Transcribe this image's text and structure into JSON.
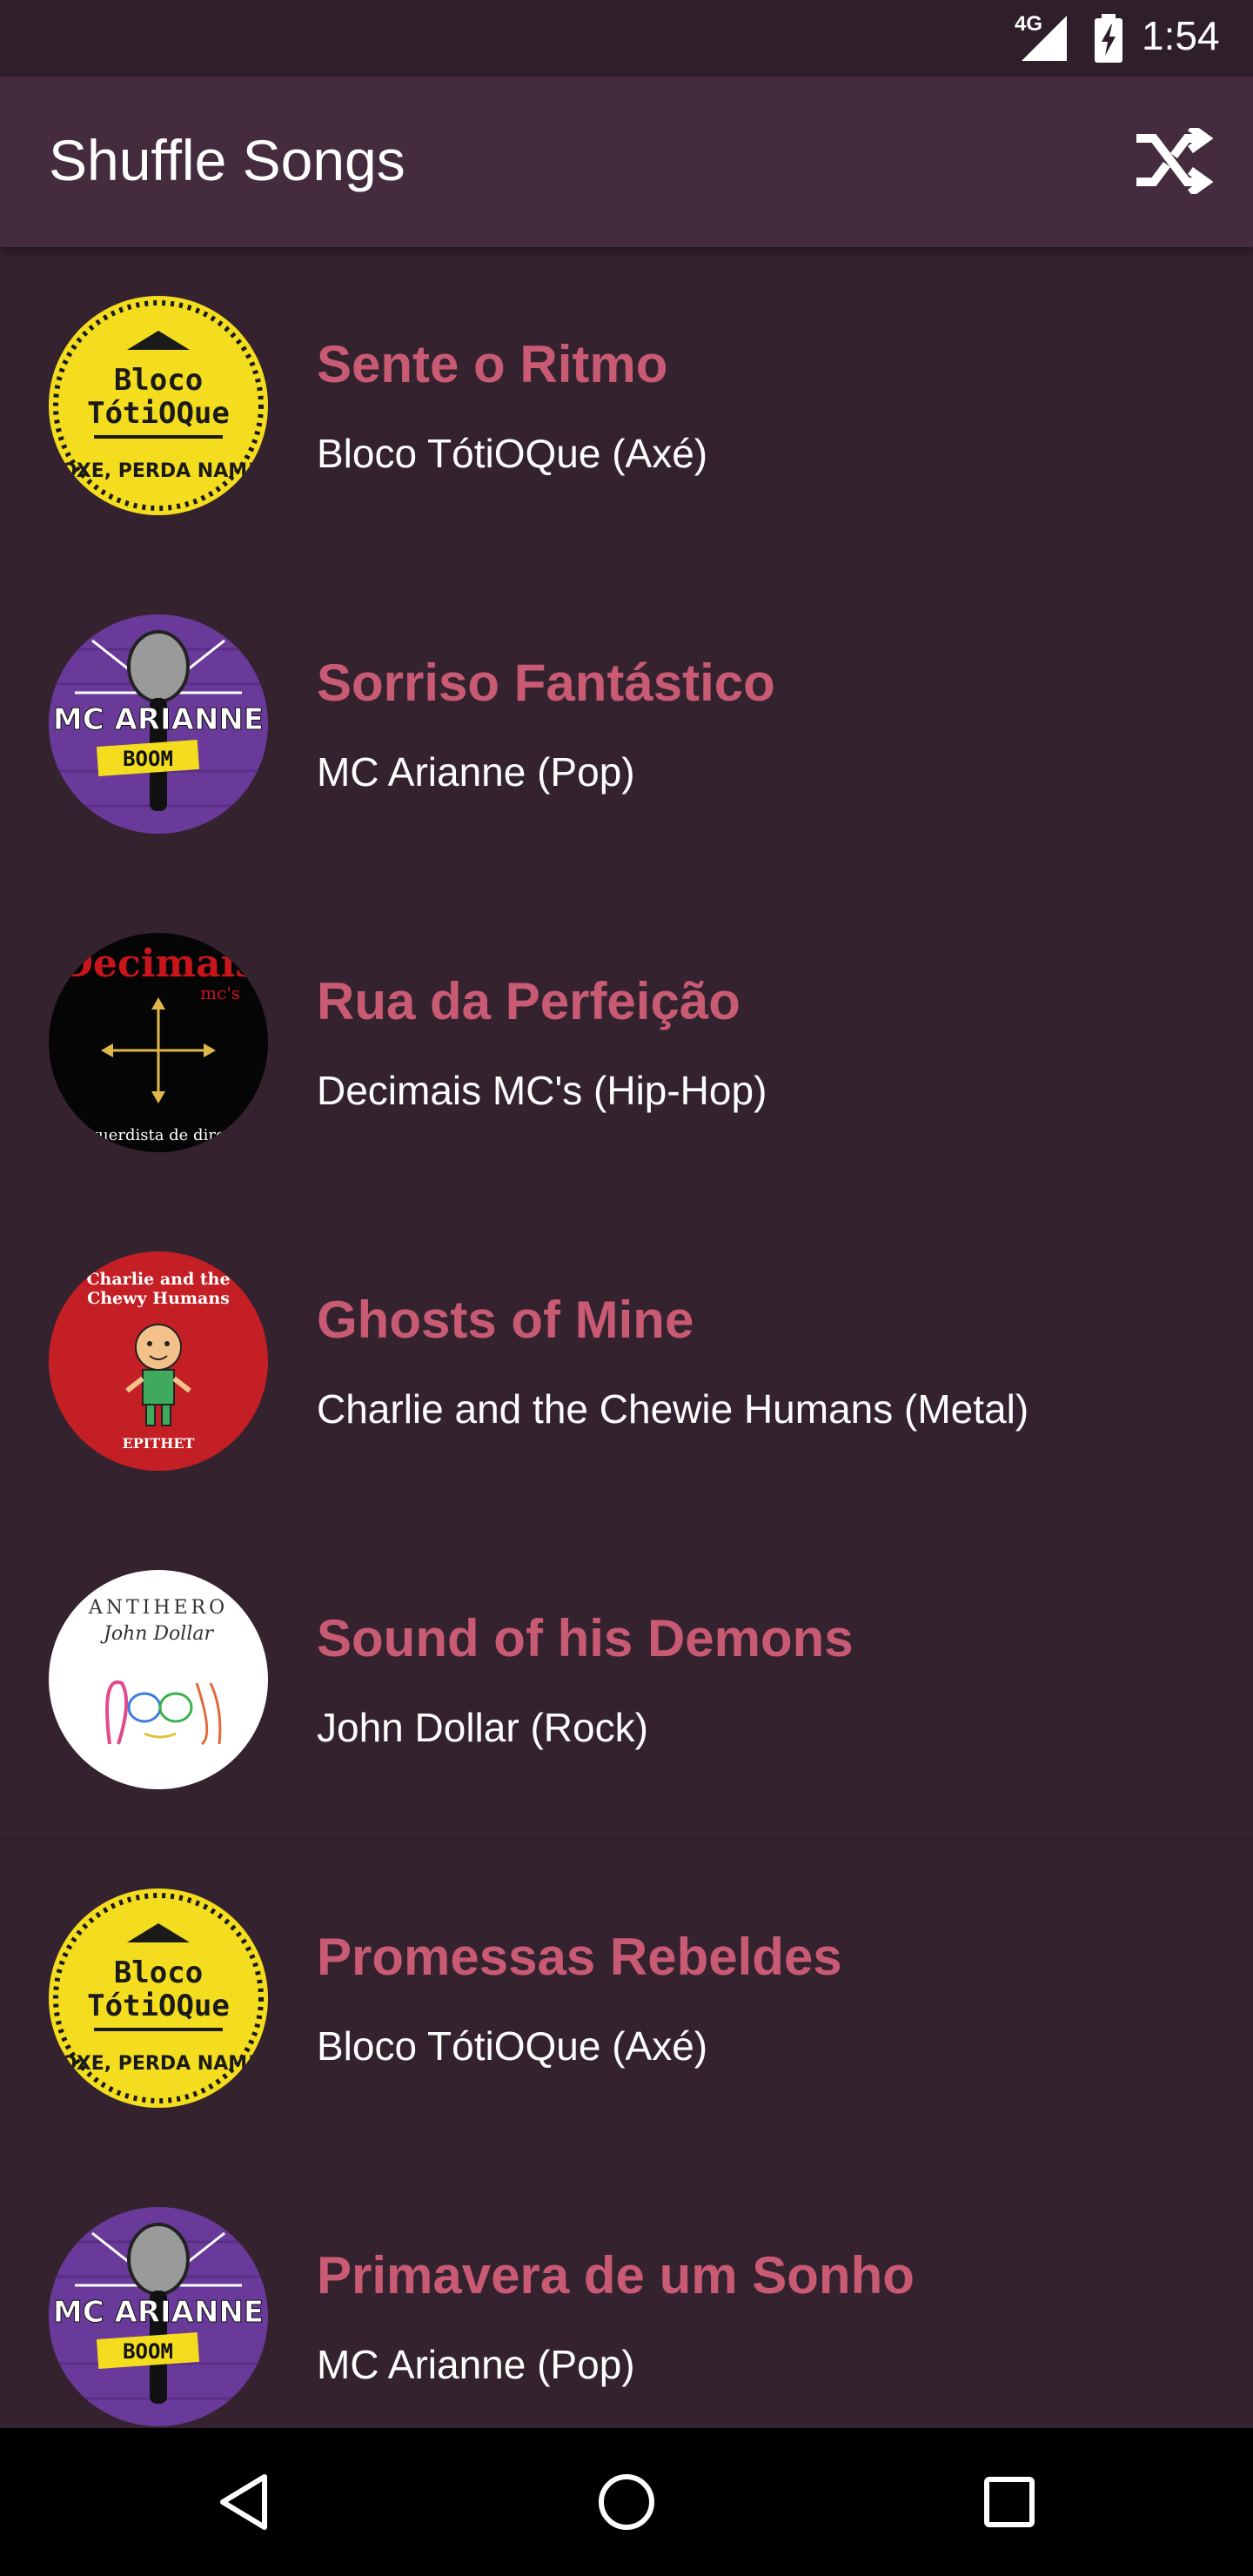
{
  "status_bar": {
    "network": "4G",
    "time": "1:54",
    "icons": [
      "signal-icon",
      "battery-charging-icon"
    ]
  },
  "app_bar": {
    "title": "Shuffle Songs",
    "action_icon": "shuffle-icon"
  },
  "songs": [
    {
      "title": "Sente o Ritmo",
      "artist": "Bloco TótiOQue (Axé)",
      "cover": "bloco"
    },
    {
      "title": "Sorriso Fantástico",
      "artist": "MC Arianne (Pop)",
      "cover": "mcarianne"
    },
    {
      "title": "Rua da Perfeição",
      "artist": "Decimais MC's (Hip-Hop)",
      "cover": "decimais"
    },
    {
      "title": "Ghosts of Mine",
      "artist": "Charlie and the Chewie Humans (Metal)",
      "cover": "charlie"
    },
    {
      "title": "Sound of his Demons",
      "artist": "John Dollar (Rock)",
      "cover": "antihero"
    },
    {
      "title": "Promessas Rebeldes",
      "artist": "Bloco TótiOQue (Axé)",
      "cover": "bloco"
    },
    {
      "title": "Primavera de um Sonho",
      "artist": "MC Arianne (Pop)",
      "cover": "mcarianne"
    }
  ],
  "covers": {
    "bloco": {
      "line1": "Bloco",
      "line2": "TótiOQue",
      "line3": "OXE, PERDA NAM!"
    },
    "mcarianne": {
      "line1": "MC ARIANNE",
      "line2": "BOOM"
    },
    "decimais": {
      "line1": "Decimais",
      "line2": "mc's",
      "line3": "esquerdista de direita"
    },
    "charlie": {
      "line1": "Charlie and the",
      "line2": "Chewy Humans",
      "line3": "EPITHET"
    },
    "antihero": {
      "line1": "ANTIHERO",
      "line2": "John Dollar"
    }
  },
  "nav_bar": {
    "buttons": [
      "back-icon",
      "home-icon",
      "recents-icon"
    ]
  },
  "colors": {
    "background": "#34232f",
    "app_bar": "#442c3e",
    "status_bar": "#2e1f2a",
    "title_accent": "#c95a74",
    "text": "#ffffff"
  }
}
